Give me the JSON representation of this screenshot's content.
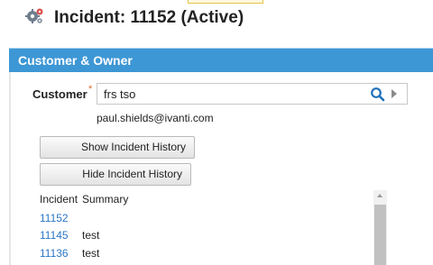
{
  "header": {
    "icon": "gears-icon",
    "title": "Incident: 11152 (Active)"
  },
  "section": {
    "title": "Customer & Owner"
  },
  "customer": {
    "label": "Customer",
    "required_marker": "*",
    "value": "frs tso",
    "email": "paul.shields@ivanti.com",
    "search_icon": "search-icon",
    "expand_icon": "triangle-right-icon"
  },
  "buttons": {
    "show_history": "Show Incident History",
    "hide_history": "Hide Incident History"
  },
  "history": {
    "columns": [
      "Incident",
      "Summary"
    ],
    "rows": [
      {
        "incident": "11152",
        "summary": ""
      },
      {
        "incident": "11145",
        "summary": "test"
      },
      {
        "incident": "11136",
        "summary": "test"
      }
    ]
  },
  "colors": {
    "section_bar": "#3d97d5",
    "link": "#2a76c6",
    "required": "#e06a2b"
  }
}
